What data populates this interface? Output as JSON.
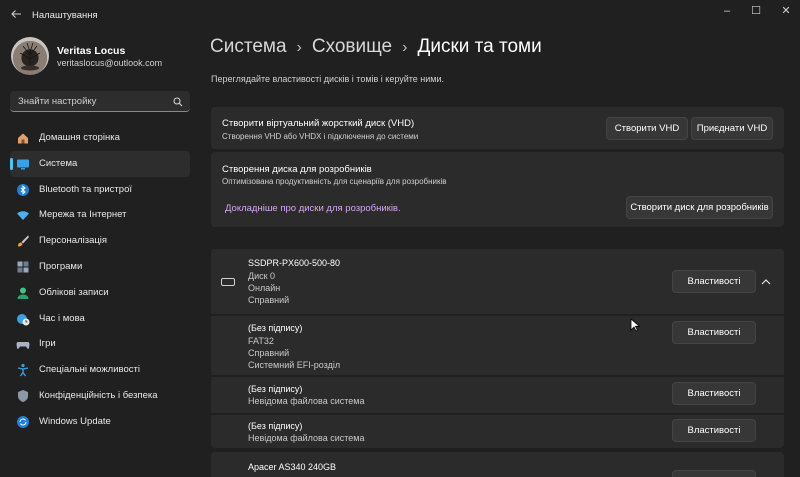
{
  "window": {
    "title": "Налаштування",
    "controls": {
      "minimize": "–",
      "maximize": "☐",
      "close": "✕"
    }
  },
  "profile": {
    "name": "Veritas Locus",
    "email": "veritaslocus@outlook.com"
  },
  "search": {
    "placeholder": "Знайти настройку"
  },
  "sidebar": {
    "items": [
      {
        "label": "Домашня сторінка",
        "icon": "home-icon"
      },
      {
        "label": "Система",
        "icon": "system-icon",
        "active": true
      },
      {
        "label": "Bluetooth та пристрої",
        "icon": "bluetooth-icon"
      },
      {
        "label": "Мережа та Інтернет",
        "icon": "network-icon"
      },
      {
        "label": "Персоналізація",
        "icon": "personalization-icon"
      },
      {
        "label": "Програми",
        "icon": "apps-icon"
      },
      {
        "label": "Облікові записи",
        "icon": "accounts-icon"
      },
      {
        "label": "Час і мова",
        "icon": "time-language-icon"
      },
      {
        "label": "Ігри",
        "icon": "gaming-icon"
      },
      {
        "label": "Спеціальні можливості",
        "icon": "accessibility-icon"
      },
      {
        "label": "Конфіденційність і безпека",
        "icon": "privacy-icon"
      },
      {
        "label": "Windows Update",
        "icon": "windows-update-icon"
      }
    ]
  },
  "breadcrumb": {
    "items": [
      "Система",
      "Сховище",
      "Диски та томи"
    ]
  },
  "page_description": "Переглядайте властивості дисків і томів і керуйте ними.",
  "vhd_card": {
    "title": "Створити віртуальний жорсткий диск (VHD)",
    "subtitle": "Створення VHD або VHDX і підключення до системи",
    "create_button": "Створити VHD",
    "attach_button": "Приєднати VHD"
  },
  "dev_card": {
    "title": "Створення диска для розробників",
    "subtitle": "Оптимізована продуктивність для сценаріїв для розробників",
    "link": "Докладніше про диски для розробників.",
    "create_button": "Створити диск для розробників"
  },
  "disk1": {
    "name": "SSDPR-PX600-500-80",
    "number": "Диск 0",
    "state": "Онлайн",
    "health": "Справний",
    "properties_button": "Властивості"
  },
  "volumes": [
    {
      "label": "(Без підпису)",
      "fs": "FAT32",
      "health": "Справний",
      "type": "Системний EFI-розділ",
      "properties_button": "Властивості"
    },
    {
      "label": "(Без підпису)",
      "fs": "Невідома файлова система",
      "properties_button": "Властивості"
    },
    {
      "label": "(Без підпису)",
      "fs": "Невідома файлова система",
      "properties_button": "Властивості"
    }
  ],
  "disk2": {
    "name": "Apacer AS340 240GB"
  },
  "colors": {
    "accent": "#4cc2ff",
    "link": "#d8a4f5",
    "background": "#202020",
    "card": "#2b2b2b"
  }
}
